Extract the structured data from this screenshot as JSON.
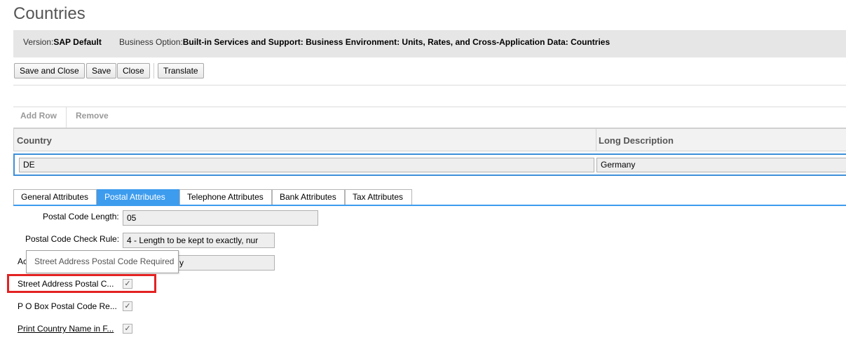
{
  "page": {
    "title": "Countries"
  },
  "info": {
    "version_label": "Version:",
    "version_value": "SAP Default",
    "business_option_label": "Business Option:",
    "business_option_value": "Built-in Services and Support: Business Environment: Units, Rates, and Cross-Application Data: Countries"
  },
  "toolbar": {
    "save_close": "Save and Close",
    "save": "Save",
    "close": "Close",
    "translate": "Translate"
  },
  "rowbar": {
    "add_row": "Add Row",
    "remove": "Remove"
  },
  "table": {
    "columns": [
      "Country",
      "Long Description"
    ],
    "rows": [
      {
        "country": "DE",
        "description": "Germany"
      }
    ]
  },
  "tabs": [
    "General Attributes",
    "Postal Attributes",
    "Telephone Attributes",
    "Bank Attributes",
    "Tax Attributes"
  ],
  "fields": {
    "postal_code_length": {
      "label": "Postal Code Length:",
      "value": "05"
    },
    "postal_code_check_rule": {
      "label": "Postal Code Check Rule:",
      "value": "4 - Length to be kept to exactly, nur"
    },
    "hidden_row": {
      "label": "Ac",
      "value": "y"
    },
    "street_address_postal_code": {
      "label": "Street Address Postal C...",
      "checked_glyph": "✓"
    },
    "po_box_postal_code": {
      "label": "P O Box Postal Code Re...",
      "checked_glyph": "✓"
    },
    "print_country_name": {
      "label": "Print Country Name in F...",
      "checked_glyph": "✓"
    }
  },
  "tooltip": {
    "text": "Street Address Postal Code Required"
  },
  "colors": {
    "accent": "#3d9cee",
    "selection_border": "#3d8fd9",
    "highlight": "#e32222"
  }
}
